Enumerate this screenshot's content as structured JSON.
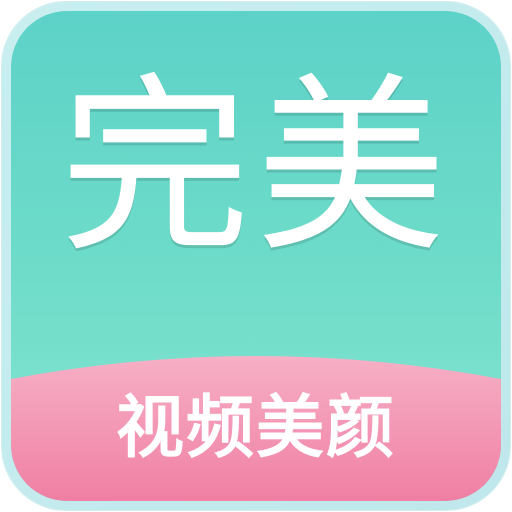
{
  "icon": {
    "title": "完美",
    "subtitle": "视频美颜",
    "colors": {
      "outer_frame": "#c8eef0",
      "background_top": "#5dd2c8",
      "background_bottom": "#86e6d2",
      "band_top": "#f6a9c2",
      "band_bottom": "#f07fa3",
      "text": "#ffffff"
    }
  }
}
